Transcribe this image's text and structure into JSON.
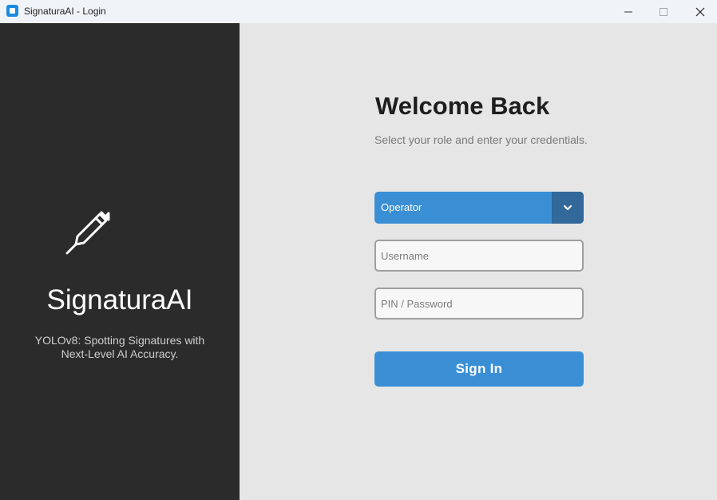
{
  "window": {
    "title": "SignaturaAI - Login",
    "controls": [
      "minimize-icon",
      "maximize-icon",
      "close-icon"
    ]
  },
  "branding": {
    "icon": "pen-icon",
    "name": "SignaturaAI",
    "tagline": "YOLOv8: Spotting Signatures with Next-Level AI Accuracy."
  },
  "login": {
    "heading": "Welcome Back",
    "subheading": "Select your role and enter your credentials.",
    "role": {
      "selected": "Operator",
      "arrow_icon": "chevron-down-icon"
    },
    "username": {
      "value": "",
      "placeholder": "Username"
    },
    "password": {
      "value": "",
      "placeholder": "PIN / Password"
    },
    "submit_label": "Sign In"
  },
  "colors": {
    "accent": "#3a8fd4",
    "accent_dark": "#32689a",
    "sidebar_bg": "#2b2b2b",
    "content_bg": "#e6e6e6"
  }
}
